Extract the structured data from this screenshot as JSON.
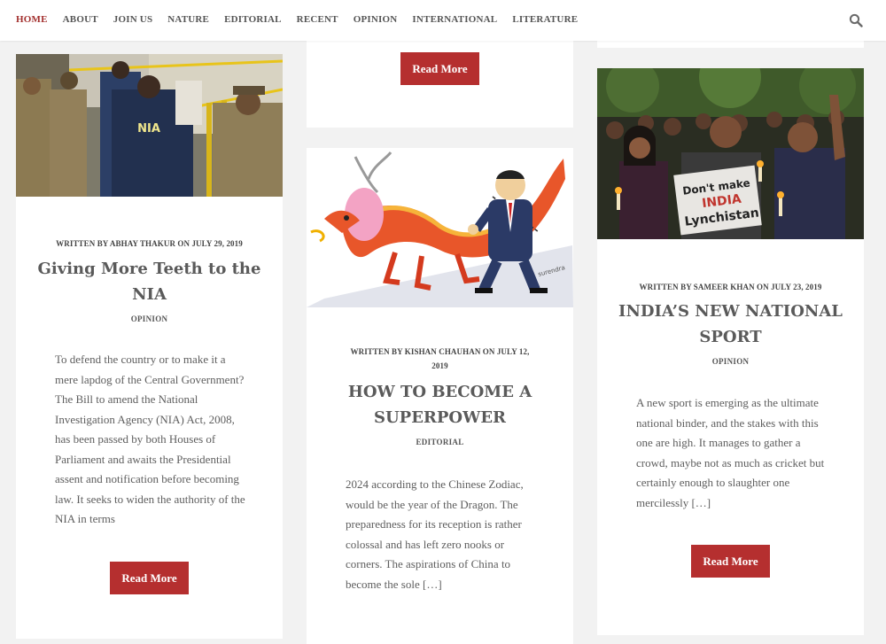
{
  "nav": {
    "items": [
      {
        "label": "HOME",
        "active": true
      },
      {
        "label": "ABOUT"
      },
      {
        "label": "JOIN US"
      },
      {
        "label": "NATURE"
      },
      {
        "label": "EDITORIAL"
      },
      {
        "label": "RECENT"
      },
      {
        "label": "OPINION"
      },
      {
        "label": "INTERNATIONAL"
      },
      {
        "label": "LITERATURE"
      }
    ],
    "search_icon": "search-icon"
  },
  "colors": {
    "accent": "#a3302e",
    "button": "#b52f2f",
    "background": "#f2f2f2",
    "card": "#ffffff"
  },
  "posts": [
    {
      "meta": "WRITTEN BY ABHAY THAKUR ON JULY 29, 2019",
      "title_line1": "Giving More Teeth to the",
      "title_line2": "NIA",
      "category": "OPINION",
      "excerpt": "To defend the country or to make it a mere lapdog of the Central Government? The Bill to amend the National Investigation Agency (NIA) Act, 2008, has been passed by both Houses of Parliament and awaits the Presidential assent and notification before becoming law. It seeks to widen the authority of the NIA in terms",
      "image_text": "NIA",
      "read_more": "Read More"
    },
    {
      "meta_line1": "WRITTEN BY KISHAN CHAUHAN ON JULY 12,",
      "meta_line2": "2019",
      "title_line1": "HOW TO BECOME A",
      "title_line2": "SUPERPOWER",
      "category": "EDITORIAL",
      "excerpt": "2024 according to the Chinese Zodiac, would be the year of the Dragon. The preparedness for its reception is rather colossal and has left zero nooks or corners. The aspirations of China to become the sole […]",
      "image_text": "surendra",
      "read_more": "Read More"
    },
    {
      "meta": "WRITTEN BY SAMEER KHAN ON JULY 23, 2019",
      "title_line1": "INDIA’S NEW NATIONAL",
      "title_line2": "SPORT",
      "category": "OPINION",
      "excerpt": "A new sport is emerging as the ultimate national binder, and the stakes with this one are high. It manages to gather a crowd, maybe not as much as cricket but certainly enough to slaughter one mercilessly […]",
      "placard": {
        "line1": "Don't make",
        "line2": "INDIA",
        "line3": "Lynchistan"
      },
      "read_more": "Read More"
    }
  ],
  "top_read_more": "Read More"
}
